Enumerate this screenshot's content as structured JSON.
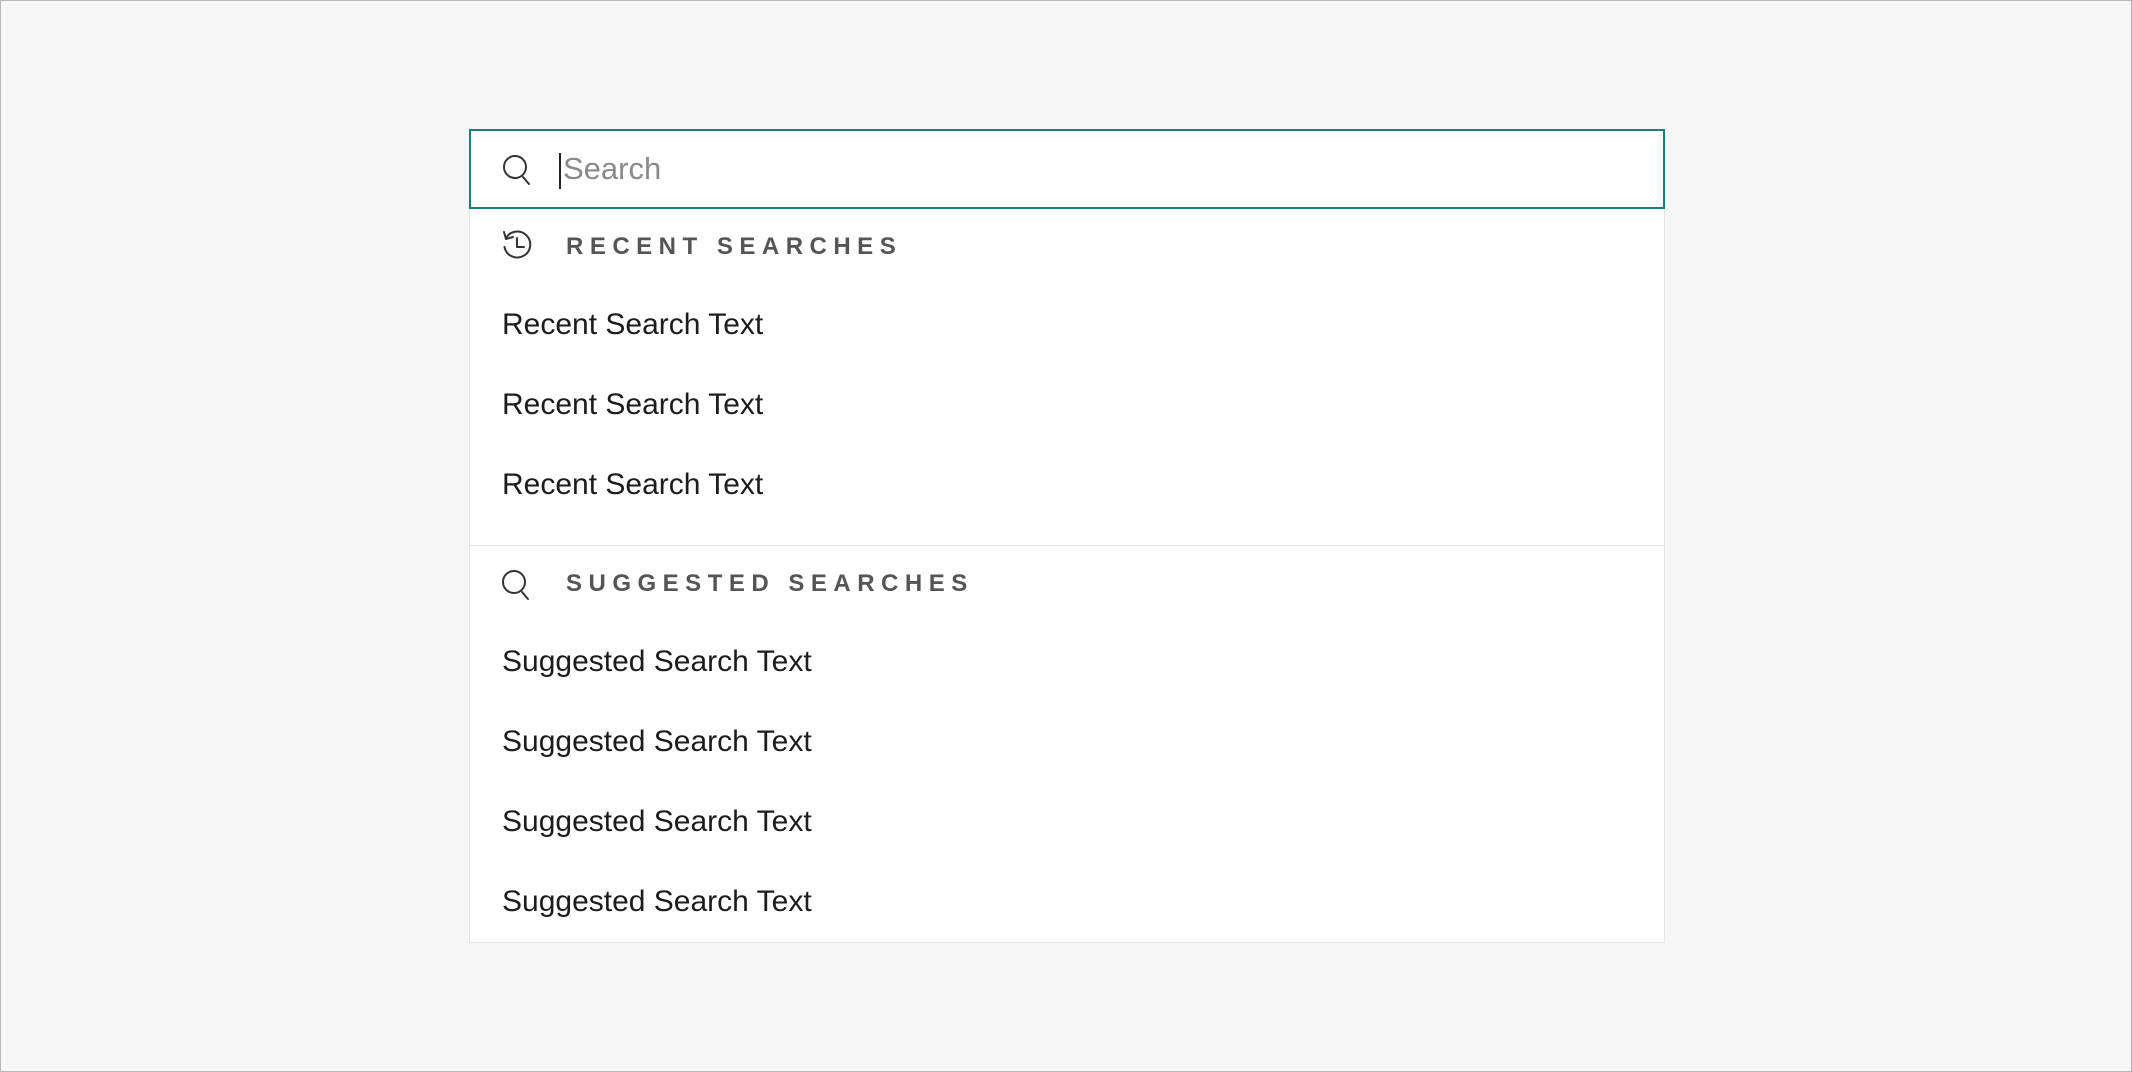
{
  "search": {
    "placeholder": "Search",
    "value": ""
  },
  "recent": {
    "title": "RECENT SEARCHES",
    "icon": "history-icon",
    "items": [
      "Recent Search Text",
      "Recent Search Text",
      "Recent Search Text"
    ]
  },
  "suggested": {
    "title": "SUGGESTED SEARCHES",
    "icon": "search-icon",
    "items": [
      "Suggested Search Text",
      "Suggested Search Text",
      "Suggested Search Text",
      "Suggested Search Text"
    ]
  },
  "colors": {
    "accent_border": "#1d7d77",
    "page_background": "#f6f6f6",
    "section_title": "#555555"
  }
}
